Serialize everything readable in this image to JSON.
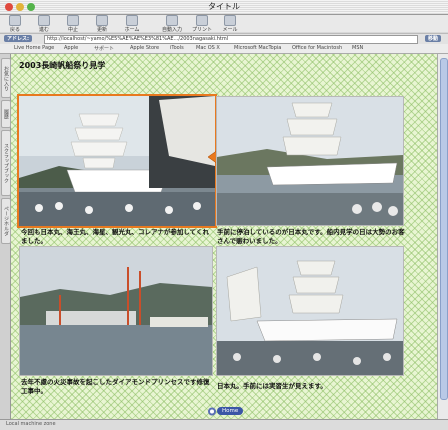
{
  "window": {
    "title": "タイトル"
  },
  "toolbar": {
    "buttons": [
      {
        "label": "戻る"
      },
      {
        "label": "進む"
      },
      {
        "label": "中止"
      },
      {
        "label": "更新"
      },
      {
        "label": "ホーム"
      },
      {
        "label": "自動入力"
      },
      {
        "label": "プリント"
      },
      {
        "label": "メール"
      }
    ]
  },
  "address": {
    "label": "アドレス:",
    "value": "http://localhost/~yamo/%E5%AE%AE%E3%81%AE.../2003nagasaki.html",
    "go_label": "移動"
  },
  "favorites": [
    "Live Home Page",
    "Apple",
    "サポート",
    "Apple Store",
    "iTools",
    "Mac OS X",
    "Microsoft MacTopia",
    "Office for Macintosh",
    "MSN"
  ],
  "sidetabs": [
    "お気に入り",
    "履歴",
    "スクラップブック",
    "ページホルダ"
  ],
  "page": {
    "title": "2003長崎帆船祭り見学",
    "captions": [
      "今回も日本丸、海王丸、海星、観光丸、コレアナが参加してくれました。",
      "手前に停泊しているのが日本丸です。船内見学の日は大勢のお客さんで賑わいました。",
      "去年不慮の火災事故を起こしたダイアモンドプリンセスです修復工事中。",
      "日本丸。手前には実習生が見えます。"
    ],
    "home_label": "Home"
  },
  "statusbar": {
    "text": "Local machine zone"
  },
  "colors": {
    "accent_orange": "#e8791f",
    "grid_green": "#8cbe64"
  }
}
